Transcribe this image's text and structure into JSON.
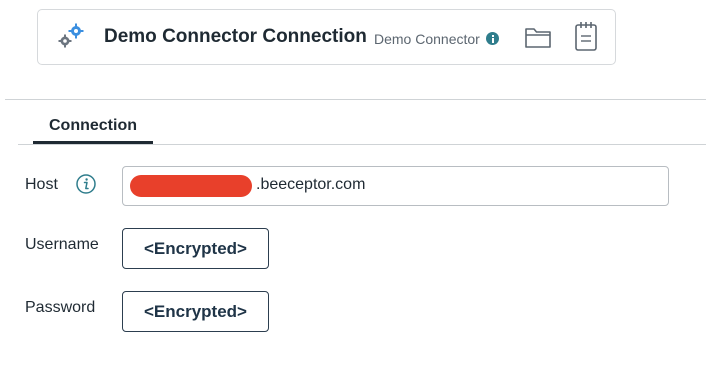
{
  "header": {
    "title": "Demo Connector Connection",
    "connector_type": "Demo Connector",
    "logo_icon": "gears-icon",
    "info_icon": "info-icon",
    "folder_icon": "folder-icon",
    "notes_icon": "notepad-icon"
  },
  "tabs": [
    {
      "label": "Connection",
      "active": true
    }
  ],
  "form": {
    "host": {
      "label": "Host",
      "value_visible_suffix": ".beeceptor.com",
      "redaction_color": "#e8402b"
    },
    "username": {
      "label": "Username",
      "value": "<Encrypted>"
    },
    "password": {
      "label": "Password",
      "value": "<Encrypted>"
    }
  },
  "colors": {
    "text": "#1f2a33",
    "accent_teal": "#2f7d8c",
    "logo_blue": "#3b8fe0",
    "logo_gray": "#6c7580"
  }
}
